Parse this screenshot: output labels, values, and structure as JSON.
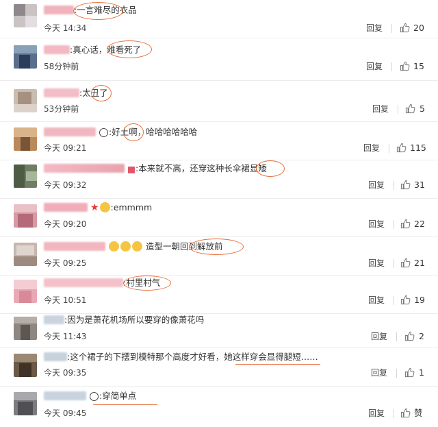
{
  "reply_label": "回复",
  "comments": [
    {
      "user_hidden": true,
      "sep": ":",
      "text": "一言难尽的衣品",
      "time": "今天 14:34",
      "likes": "20"
    },
    {
      "user_hidden": true,
      "sep": ":",
      "text": "真心话，难看死了",
      "time": "58分钟前",
      "likes": "15"
    },
    {
      "user_hidden": true,
      "sep": ":",
      "text": "太丑了",
      "time": "53分钟前",
      "likes": "5"
    },
    {
      "user_hidden": true,
      "sep": ":",
      "text": "好土啊，哈哈哈哈哈哈",
      "time": "今天 09:21",
      "likes": "115"
    },
    {
      "user_hidden": true,
      "sep": ":",
      "text": "本来就不高，还穿这种长伞裙显矮",
      "time": "今天 09:32",
      "likes": "31"
    },
    {
      "user_hidden": true,
      "sep": ":",
      "text": "emmmm",
      "time": "今天 09:20",
      "likes": "22"
    },
    {
      "user_hidden": true,
      "sep": "",
      "text": "造型一朝回到解放前",
      "time": "今天 09:25",
      "likes": "21"
    },
    {
      "user_hidden": true,
      "sep": ":",
      "text": "村里村气",
      "time": "今天 10:51",
      "likes": "19"
    },
    {
      "user_hidden": true,
      "sep": ":",
      "text": "因为是萧花机场所以要穿的像萧花吗",
      "time": "今天 11:43",
      "likes": "2"
    },
    {
      "user_hidden": true,
      "sep": ":",
      "text": "这个裙子的下摆到模特那个高度才好看，她这样穿会显得腿短……",
      "time": "今天 09:35",
      "likes": "1"
    },
    {
      "user_hidden": true,
      "sep": ":",
      "text": "穿简单点",
      "time": "今天 09:45",
      "likes": "赞"
    }
  ],
  "colors": {
    "annotation": "#e8703a",
    "emoji_yellow": "#f5c542",
    "star_red": "#e53935"
  },
  "icons": {
    "like": "thumbs-up-icon",
    "emoji": "emoji-icon",
    "badge": "badge-icon",
    "panda": "panda-emoji-icon",
    "star": "star-icon"
  }
}
